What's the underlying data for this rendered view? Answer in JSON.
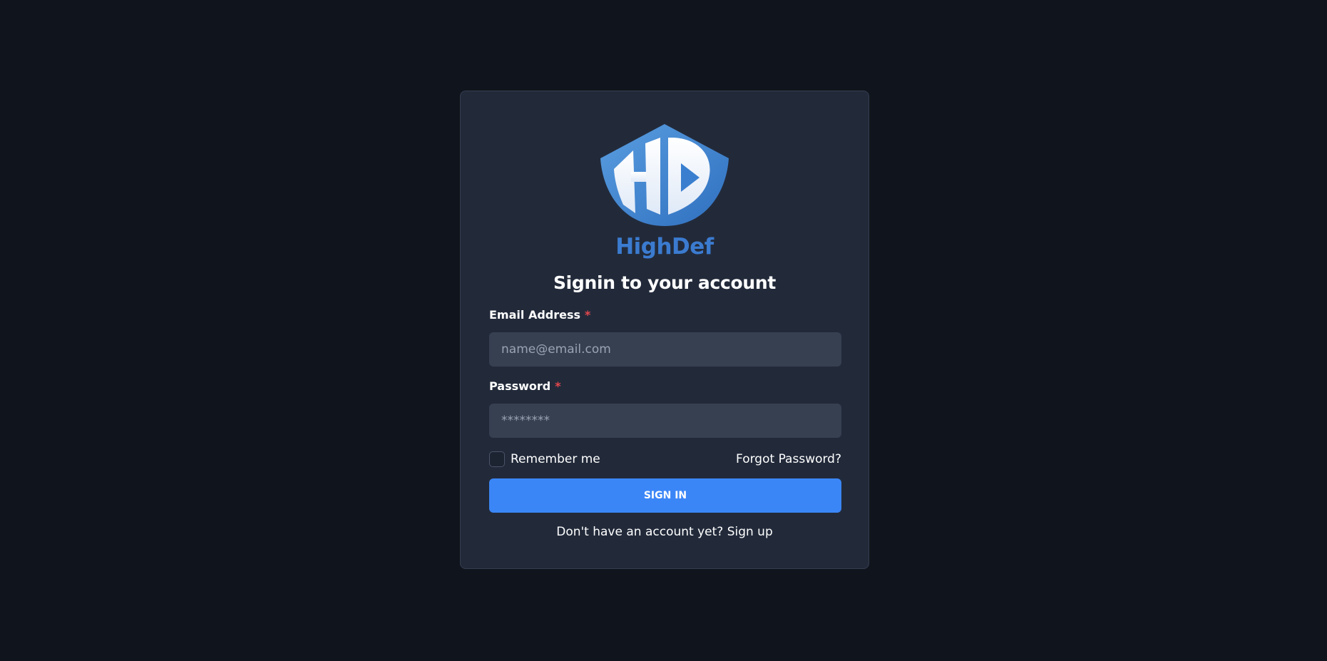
{
  "brand": {
    "name": "HighDef",
    "logo_text": "HD",
    "logo_icon": "shield-logo",
    "color": "#3b7bd0"
  },
  "page": {
    "heading": "Signin to your account"
  },
  "form": {
    "email": {
      "label": "Email Address",
      "required_mark": "*",
      "placeholder": "name@email.com",
      "value": ""
    },
    "password": {
      "label": "Password",
      "required_mark": "*",
      "placeholder": "********",
      "value": ""
    },
    "remember_me": {
      "label": "Remember me",
      "checked": false
    },
    "forgot_password": "Forgot Password?",
    "submit_label": "SIGN IN"
  },
  "footer": {
    "prompt": "Don't have an account yet?",
    "link": "Sign up"
  },
  "colors": {
    "background": "#10141c",
    "card": "#222a3a",
    "input": "#374051",
    "button": "#3b86f7",
    "required": "#e5484d"
  }
}
